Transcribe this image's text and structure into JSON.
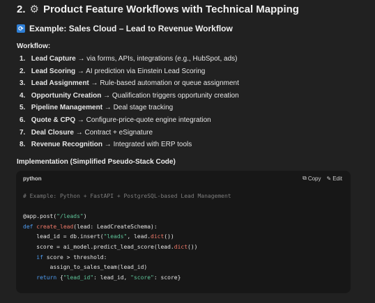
{
  "section": {
    "number": "2.",
    "icon": "gear-icon",
    "title": "Product Feature Workflows with Technical Mapping"
  },
  "example": {
    "icon": "cycle-icon",
    "title": "Example: Sales Cloud – Lead to Revenue Workflow"
  },
  "workflow": {
    "heading": "Workflow:",
    "steps": [
      {
        "num": "1.",
        "title": "Lead Capture",
        "desc": " → via forms, APIs, integrations (e.g., HubSpot, ads)"
      },
      {
        "num": "2.",
        "title": "Lead Scoring",
        "desc": " → AI prediction via Einstein Lead Scoring"
      },
      {
        "num": "3.",
        "title": "Lead Assignment",
        "desc": " → Rule-based automation or queue assignment"
      },
      {
        "num": "4.",
        "title": "Opportunity Creation",
        "desc": " → Qualification triggers opportunity creation"
      },
      {
        "num": "5.",
        "title": "Pipeline Management",
        "desc": " → Deal stage tracking"
      },
      {
        "num": "6.",
        "title": "Quote & CPQ",
        "desc": " → Configure-price-quote engine integration"
      },
      {
        "num": "7.",
        "title": "Deal Closure",
        "desc": " → Contract + eSignature"
      },
      {
        "num": "8.",
        "title": "Revenue Recognition",
        "desc": " → Integrated with ERP tools"
      }
    ]
  },
  "implementation": {
    "heading": "Implementation (Simplified Pseudo-Stack Code)"
  },
  "code_block": {
    "language": "python",
    "copy_label": "Copy",
    "edit_label": "Edit",
    "lines": {
      "comment": "# Example: Python + FastAPI + PostgreSQL-based Lead Management",
      "decorator_pre": "@app.post(",
      "decorator_str": "\"/leads\"",
      "decorator_post": ")",
      "def_kw": "def",
      "def_fn": "create_lead",
      "def_rest": "(lead: LeadCreateSchema):",
      "l3_a": "    lead_id = db.insert(",
      "l3_str": "\"leads\"",
      "l3_b": ", lead.",
      "l3_fn": "dict",
      "l3_c": "())",
      "l4_a": "    score = ai_model.predict_lead_score(lead.",
      "l4_fn": "dict",
      "l4_c": "())",
      "l5_kw": "if",
      "l5_rest": " score > threshold:",
      "l6": "        assign_to_sales_team(lead_id)",
      "l7_kw": "return",
      "l7_a": " {",
      "l7_s1": "\"lead_id\"",
      "l7_b": ": lead_id, ",
      "l7_s2": "\"score\"",
      "l7_c": ": score}"
    }
  }
}
